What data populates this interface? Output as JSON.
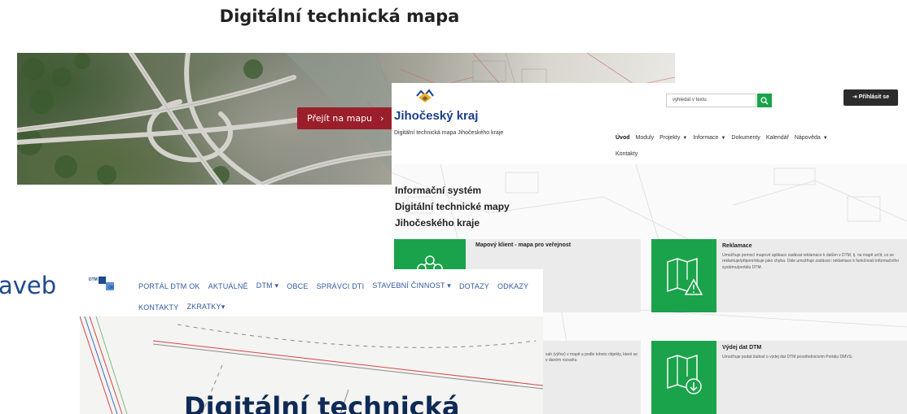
{
  "page_title": "Digitální technická mapa",
  "hero": {
    "button_label": "Přejít na mapu",
    "button_icon": "chevron-right-icon",
    "button_color": "#9a1f2a"
  },
  "jk": {
    "brand": "Jihočeský kraj",
    "subtitle": "Digitální technická mapa Jihočeského kraje",
    "search_placeholder": "vyhledat v textu",
    "login_label": "Přihlásit se",
    "nav_row1": [
      "Úvod",
      "Moduly",
      "Projekty",
      "Informace",
      "Dokumenty",
      "Kalendář",
      "Nápověda"
    ],
    "nav_row2": [
      "Kontakty"
    ],
    "heading_lines": [
      "Informační systém",
      "Digitální technické mapy",
      "Jihočeského kraje"
    ],
    "cards": [
      {
        "title": "Mapový klient - mapa pro veřejnost",
        "desc": ""
      },
      {
        "title": "Reklamace",
        "desc": "Umožňuje pomocí mapové aplikace zadávat reklamace k datům v DTM, tj. na mapě určit, co se reklamuje/připomínkuje jako chyba. Dále umožňuje zadávat i reklamace k funkčnosti informačního systému/portálu DTM."
      },
      {
        "title": "Výdej dat DTM",
        "desc": "Umožňuje podat žádost o výdej dat DTM prostřednictvím Portálu DMVS."
      }
    ],
    "partial_text": "sah (výřez) v mapě a podle tohoto objekty, které se v daném rozsahu",
    "accent_color": "#1aa34a",
    "brand_color": "#1c3f8a"
  },
  "dtm": {
    "logo_top": "DTM",
    "logo_bottom": "OK",
    "menu_row1": [
      "PORTÁL DTM OK",
      "AKTUÁLNĚ",
      "DTM ▾",
      "OBCE",
      "SPRÁVCI DTI",
      "STAVEBNÍ ČINNOST ▾",
      "DOTAZY",
      "ODKAZY"
    ],
    "menu_row2": [
      "KONTAKTY",
      "ZKRATKY▾"
    ],
    "big_title": "Digitální technická",
    "link_color": "#2f5a9e"
  },
  "left_partial": "aveb"
}
